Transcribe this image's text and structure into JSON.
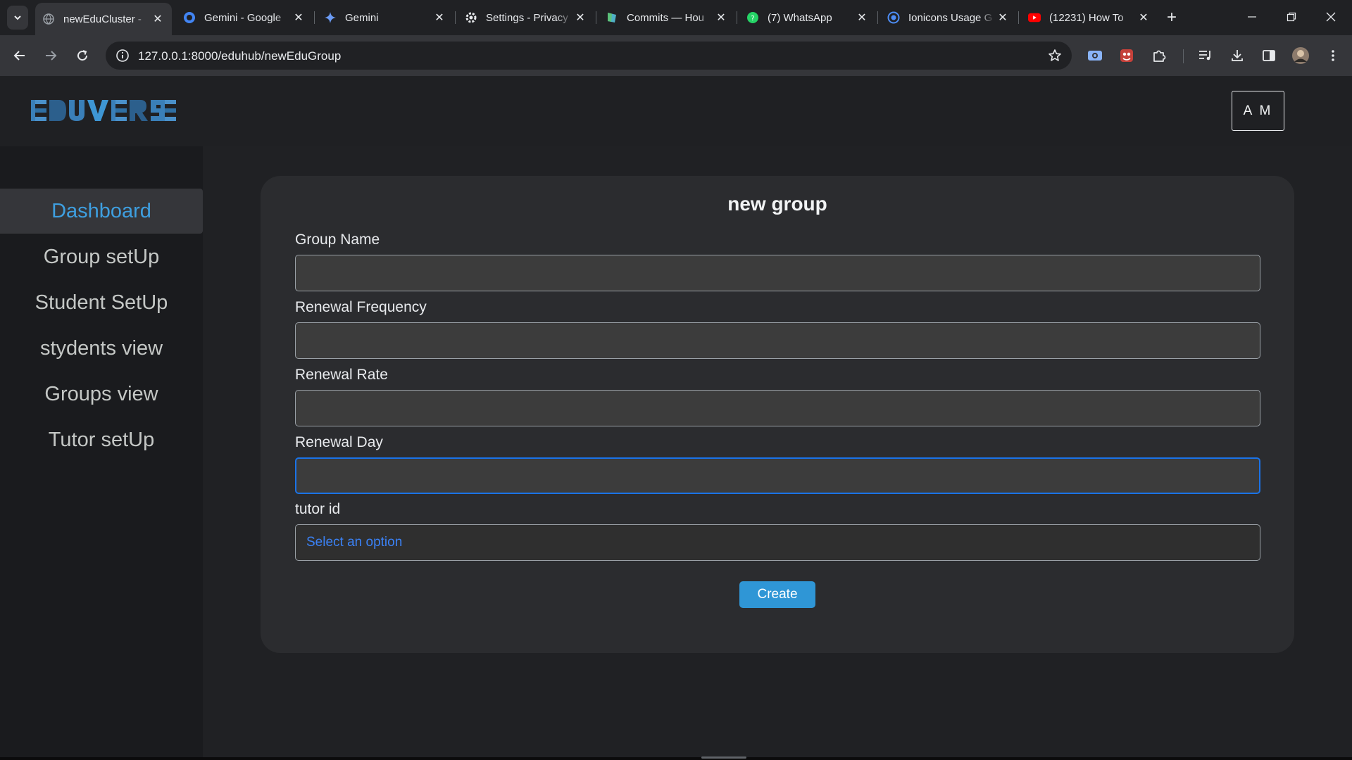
{
  "browser": {
    "tabs": [
      {
        "title": "newEduCluster - ",
        "favicon": "globe-icon",
        "active": true
      },
      {
        "title": "Gemini - Google",
        "favicon": "google-icon",
        "active": false
      },
      {
        "title": "Gemini",
        "favicon": "gemini-sparkle-icon",
        "active": false
      },
      {
        "title": "Settings - Privacy",
        "favicon": "gear-icon",
        "active": false
      },
      {
        "title": "Commits — Hou",
        "favicon": "commits-icon",
        "active": false
      },
      {
        "title": "(7) WhatsApp",
        "favicon": "whatsapp-icon",
        "active": false
      },
      {
        "title": "Ionicons Usage G",
        "favicon": "ionicons-icon",
        "active": false
      },
      {
        "title": "(12231) How To",
        "favicon": "youtube-icon",
        "active": false
      }
    ],
    "url": "127.0.0.1:8000/eduhub/newEduGroup"
  },
  "app": {
    "logo_text": "EDUVERSE",
    "avatar_initials": "A M",
    "sidebar": {
      "items": [
        {
          "label": "Dashboard",
          "active": true
        },
        {
          "label": "Group setUp",
          "active": false
        },
        {
          "label": "Student SetUp",
          "active": false
        },
        {
          "label": "stydents view",
          "active": false
        },
        {
          "label": "Groups view",
          "active": false
        },
        {
          "label": "Tutor setUp",
          "active": false
        }
      ]
    },
    "form": {
      "title": "new group",
      "fields": [
        {
          "label": "Group Name",
          "value": ""
        },
        {
          "label": "Renewal Frequency",
          "value": ""
        },
        {
          "label": "Renewal Rate",
          "value": ""
        },
        {
          "label": "Renewal Day",
          "value": "",
          "focused": true
        }
      ],
      "tutor": {
        "label": "tutor id",
        "selected": "Select an option"
      },
      "submit_label": "Create"
    }
  },
  "colors": {
    "accent": "#3e9fe0",
    "button": "#2f96d6",
    "focus": "#1a73e8",
    "select_text": "#3b82f6"
  }
}
